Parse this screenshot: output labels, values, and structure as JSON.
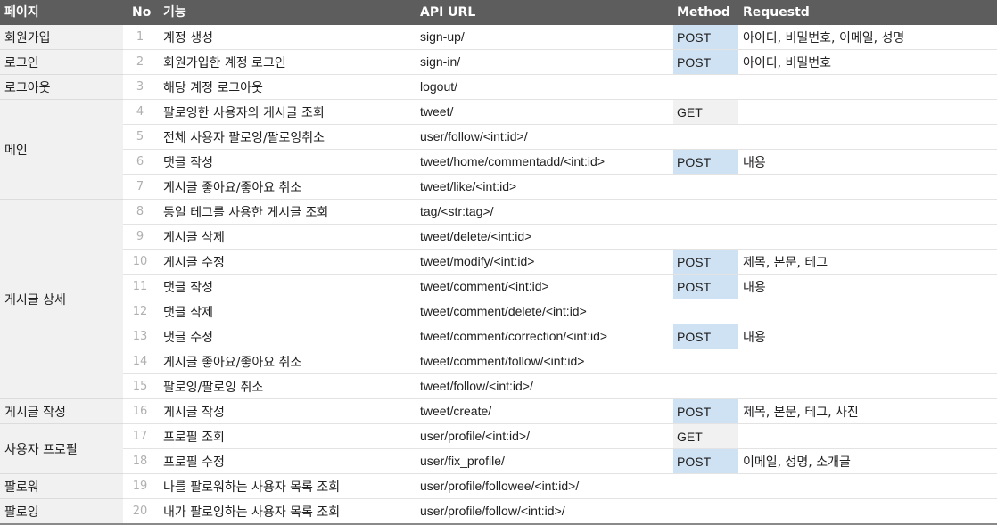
{
  "table": {
    "headers": {
      "page": "페이지",
      "no": "No",
      "func": "기능",
      "url": "API URL",
      "method": "Method",
      "request": "Requestd"
    },
    "page_groups": [
      {
        "name": "회원가입",
        "rows": 1
      },
      {
        "name": "로그인",
        "rows": 1
      },
      {
        "name": "로그아웃",
        "rows": 1
      },
      {
        "name": "메인",
        "rows": 4
      },
      {
        "name": "게시글 상세",
        "rows": 8
      },
      {
        "name": "게시글 작성",
        "rows": 1
      },
      {
        "name": "사용자 프로필",
        "rows": 2
      },
      {
        "name": "팔로워",
        "rows": 1
      },
      {
        "name": "팔로잉",
        "rows": 1
      }
    ],
    "rows": [
      {
        "no": "1",
        "func": "계정 생성",
        "url": "sign-up/",
        "method": "POST",
        "request": "아이디, 비밀번호, 이메일, 성명"
      },
      {
        "no": "2",
        "func": "회원가입한 계정 로그인",
        "url": "sign-in/",
        "method": "POST",
        "request": "아이디, 비밀번호"
      },
      {
        "no": "3",
        "func": "해당 계정 로그아웃",
        "url": "logout/",
        "method": "",
        "request": ""
      },
      {
        "no": "4",
        "func": "팔로잉한 사용자의 게시글 조회",
        "url": "tweet/",
        "method": "GET",
        "request": ""
      },
      {
        "no": "5",
        "func": "전체 사용자 팔로잉/팔로잉취소",
        "url": "user/follow/<int:id>/",
        "method": "",
        "request": ""
      },
      {
        "no": "6",
        "func": "댓글 작성",
        "url": "tweet/home/commentadd/<int:id>",
        "method": "POST",
        "request": "내용"
      },
      {
        "no": "7",
        "func": "게시글 좋아요/좋아요 취소",
        "url": "tweet/like/<int:id>",
        "method": "",
        "request": ""
      },
      {
        "no": "8",
        "func": "동일 테그를 사용한 게시글 조회",
        "url": "tag/<str:tag>/",
        "method": "",
        "request": ""
      },
      {
        "no": "9",
        "func": "게시글 삭제",
        "url": "tweet/delete/<int:id>",
        "method": "",
        "request": ""
      },
      {
        "no": "10",
        "func": "게시글 수정",
        "url": "tweet/modify/<int:id>",
        "method": "POST",
        "request": "제목, 본문, 테그"
      },
      {
        "no": "11",
        "func": "댓글 작성",
        "url": "tweet/comment/<int:id>",
        "method": "POST",
        "request": "내용"
      },
      {
        "no": "12",
        "func": "댓글 삭제",
        "url": "tweet/comment/delete/<int:id>",
        "method": "",
        "request": ""
      },
      {
        "no": "13",
        "func": "댓글 수정",
        "url": "tweet/comment/correction/<int:id>",
        "method": "POST",
        "request": "내용"
      },
      {
        "no": "14",
        "func": "게시글 좋아요/좋아요 취소",
        "url": "tweet/comment/follow/<int:id>",
        "method": "",
        "request": ""
      },
      {
        "no": "15",
        "func": "팔로잉/팔로잉 취소",
        "url": "tweet/follow/<int:id>/",
        "method": "",
        "request": ""
      },
      {
        "no": "16",
        "func": "게시글 작성",
        "url": "tweet/create/",
        "method": "POST",
        "request": "제목, 본문, 테그, 사진"
      },
      {
        "no": "17",
        "func": "프로필 조회",
        "url": "user/profile/<int:id>/",
        "method": "GET",
        "request": ""
      },
      {
        "no": "18",
        "func": "프로필 수정",
        "url": "user/fix_profile/",
        "method": "POST",
        "request": "이메일, 성명, 소개글"
      },
      {
        "no": "19",
        "func": "나를 팔로워하는 사용자 목록 조회",
        "url": "user/profile/followee/<int:id>/",
        "method": "",
        "request": ""
      },
      {
        "no": "20",
        "func": "내가 팔로잉하는 사용자 목록 조회",
        "url": "user/profile/follow/<int:id>/",
        "method": "",
        "request": ""
      }
    ]
  },
  "colors": {
    "header_bg": "#5d5d5d",
    "post_bg": "#cfe2f3",
    "get_bg": "#f1f1f1",
    "page_col_bg": "#f1f1f1"
  }
}
